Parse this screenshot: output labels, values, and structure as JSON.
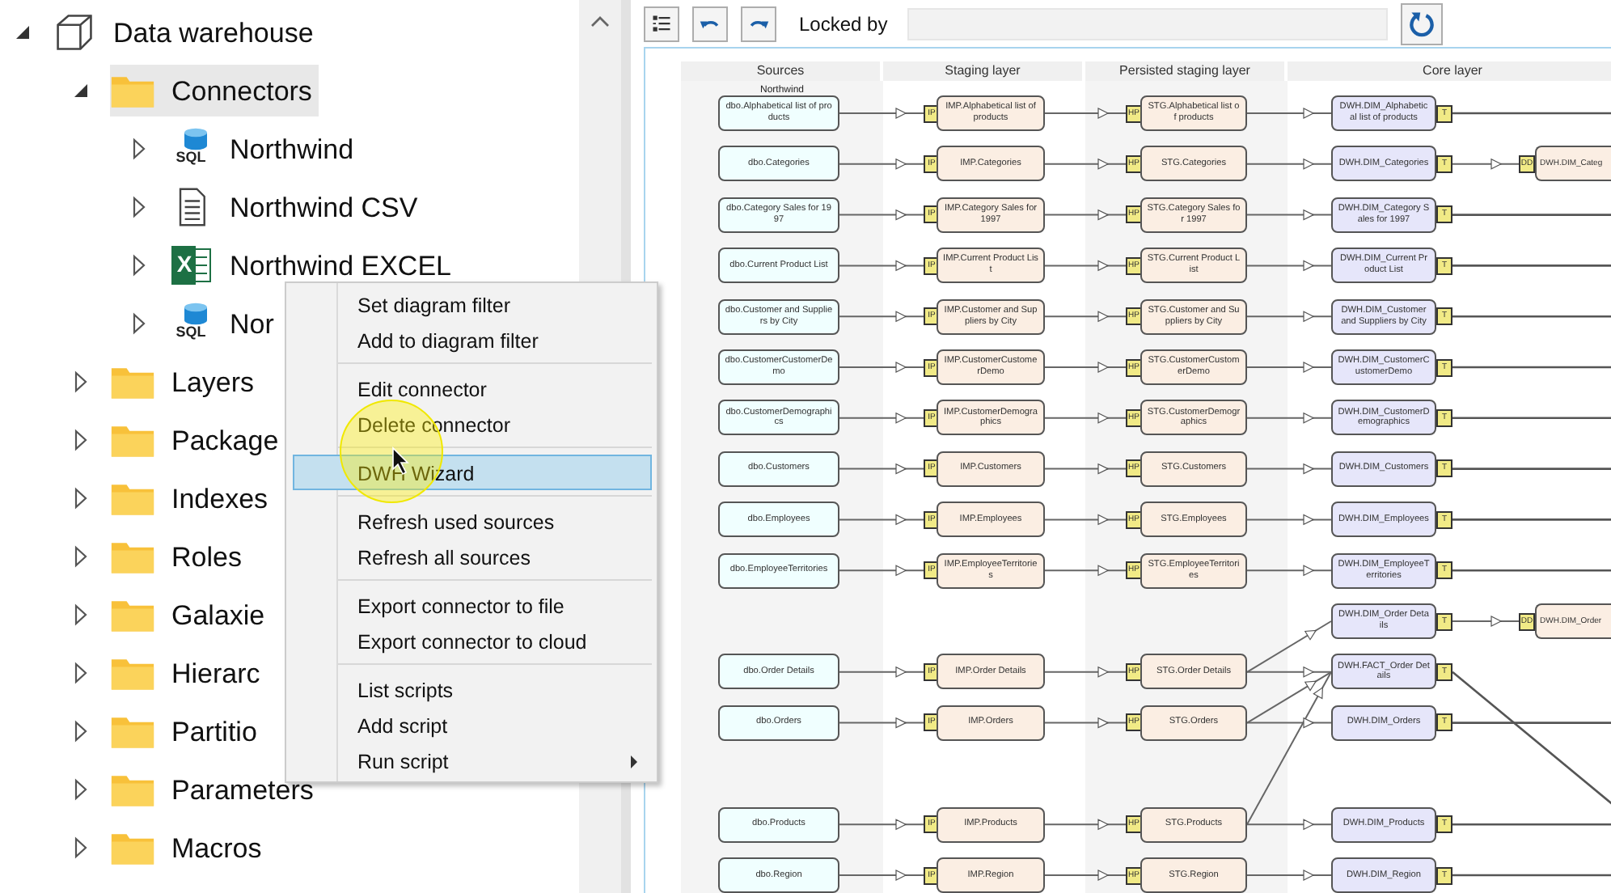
{
  "tree": [
    {
      "label": "Data warehouse",
      "kind": "warehouse",
      "expanded": true,
      "selected": false,
      "children": [
        {
          "label": "Connectors",
          "kind": "folder",
          "expanded": true,
          "selected": true,
          "children": [
            {
              "label": "Northwind",
              "kind": "sql",
              "icon_label": "SQL",
              "expanded": false,
              "selected": false
            },
            {
              "label": "Northwind CSV",
              "kind": "csv",
              "expanded": false,
              "selected": false
            },
            {
              "label": "Northwind EXCEL",
              "kind": "excel",
              "icon_label": "X",
              "expanded": false,
              "selected": false
            },
            {
              "label": "Nor",
              "kind": "sql",
              "icon_label": "SQL",
              "expanded": false,
              "selected": false
            }
          ]
        },
        {
          "label": "Layers",
          "kind": "folder",
          "expanded": false,
          "selected": false
        },
        {
          "label": "Package",
          "kind": "folder",
          "expanded": false,
          "selected": false
        },
        {
          "label": "Indexes",
          "kind": "folder",
          "expanded": false,
          "selected": false
        },
        {
          "label": "Roles",
          "kind": "folder",
          "expanded": false,
          "selected": false
        },
        {
          "label": "Galaxie",
          "kind": "folder",
          "expanded": false,
          "selected": false
        },
        {
          "label": "Hierarc",
          "kind": "folder",
          "expanded": false,
          "selected": false
        },
        {
          "label": "Partitio",
          "kind": "folder",
          "expanded": false,
          "selected": false
        },
        {
          "label": "Parameters",
          "kind": "folder",
          "expanded": false,
          "selected": false
        },
        {
          "label": "Macros",
          "kind": "folder",
          "expanded": false,
          "selected": false
        }
      ]
    }
  ],
  "context_menu": {
    "groups": [
      [
        {
          "label": "Set diagram filter",
          "selected": false,
          "submenu": false
        },
        {
          "label": "Add to diagram filter",
          "selected": false,
          "submenu": false
        }
      ],
      [
        {
          "label": "Edit connector",
          "selected": false,
          "submenu": false
        },
        {
          "label": "Delete connector",
          "selected": false,
          "submenu": false
        }
      ],
      [
        {
          "label": "DWH Wizard",
          "selected": true,
          "submenu": false
        }
      ],
      [
        {
          "label": "Refresh used sources",
          "selected": false,
          "submenu": false
        },
        {
          "label": "Refresh all sources",
          "selected": false,
          "submenu": false
        }
      ],
      [
        {
          "label": "Export connector to file",
          "selected": false,
          "submenu": false
        },
        {
          "label": "Export connector to cloud",
          "selected": false,
          "submenu": false
        }
      ],
      [
        {
          "label": "List scripts",
          "selected": false,
          "submenu": false
        },
        {
          "label": "Add script",
          "selected": false,
          "submenu": false
        },
        {
          "label": "Run script",
          "selected": false,
          "submenu": true
        }
      ]
    ]
  },
  "toolbar": {
    "locked_by_label": "Locked by"
  },
  "diagram": {
    "columns": [
      {
        "title": "Sources",
        "subtitle": "Northwind"
      },
      {
        "title": "Staging layer"
      },
      {
        "title": "Persisted staging layer"
      },
      {
        "title": "Core layer"
      }
    ],
    "rows": [
      {
        "source": "dbo.Alphabetical list of products",
        "staging": {
          "badge": "IP",
          "label": "IMP.Alphabetical list of products"
        },
        "persisted": {
          "badge": "HP",
          "label": "STG.Alphabetical list of products"
        },
        "core": {
          "kind": "dimension",
          "label": "DWH.DIM_Alphabetical list of products",
          "badge": "T"
        }
      },
      {
        "source": "dbo.Categories",
        "staging": {
          "badge": "IP",
          "label": "IMP.Categories"
        },
        "persisted": {
          "badge": "HP",
          "label": "STG.Categories"
        },
        "core": {
          "kind": "dimension",
          "label": "DWH.DIM_Categories",
          "badge": "T"
        },
        "mart": {
          "badge": "DD",
          "label": "DWH.DIM_Categ"
        }
      },
      {
        "source": "dbo.Category Sales for 1997",
        "staging": {
          "badge": "IP",
          "label": "IMP.Category Sales for 1997"
        },
        "persisted": {
          "badge": "HP",
          "label": "STG.Category Sales for 1997"
        },
        "core": {
          "kind": "dimension",
          "label": "DWH.DIM_Category Sales for 1997",
          "badge": "T"
        }
      },
      {
        "source": "dbo.Current Product List",
        "staging": {
          "badge": "IP",
          "label": "IMP.Current Product List"
        },
        "persisted": {
          "badge": "HP",
          "label": "STG.Current Product List"
        },
        "core": {
          "kind": "dimension",
          "label": "DWH.DIM_Current Product List",
          "badge": "T"
        }
      },
      {
        "source": "dbo.Customer and Suppliers by City",
        "staging": {
          "badge": "IP",
          "label": "IMP.Customer and Suppliers by City"
        },
        "persisted": {
          "badge": "HP",
          "label": "STG.Customer and Suppliers by City"
        },
        "core": {
          "kind": "dimension",
          "label": "DWH.DIM_Customer and Suppliers by City",
          "badge": "T"
        }
      },
      {
        "source": "dbo.CustomerCustomerDemo",
        "staging": {
          "badge": "IP",
          "label": "IMP.CustomerCustomerDemo"
        },
        "persisted": {
          "badge": "HP",
          "label": "STG.CustomerCustomerDemo"
        },
        "core": {
          "kind": "dimension",
          "label": "DWH.DIM_CustomerCustomerDemo",
          "badge": "T"
        }
      },
      {
        "source": "dbo.CustomerDemographics",
        "staging": {
          "badge": "IP",
          "label": "IMP.CustomerDemographics"
        },
        "persisted": {
          "badge": "HP",
          "label": "STG.CustomerDemographics"
        },
        "core": {
          "kind": "dimension",
          "label": "DWH.DIM_CustomerDemographics",
          "badge": "T"
        }
      },
      {
        "source": "dbo.Customers",
        "staging": {
          "badge": "IP",
          "label": "IMP.Customers"
        },
        "persisted": {
          "badge": "HP",
          "label": "STG.Customers"
        },
        "core": {
          "kind": "dimension",
          "label": "DWH.DIM_Customers",
          "badge": "T"
        }
      },
      {
        "source": "dbo.Employees",
        "staging": {
          "badge": "IP",
          "label": "IMP.Employees"
        },
        "persisted": {
          "badge": "HP",
          "label": "STG.Employees"
        },
        "core": {
          "kind": "dimension",
          "label": "DWH.DIM_Employees",
          "badge": "T"
        }
      },
      {
        "source": "dbo.EmployeeTerritories",
        "staging": {
          "badge": "IP",
          "label": "IMP.EmployeeTerritories"
        },
        "persisted": {
          "badge": "HP",
          "label": "STG.EmployeeTerritories"
        },
        "core": {
          "kind": "dimension",
          "label": "DWH.DIM_EmployeeTerritories",
          "badge": "T"
        }
      },
      {
        "core": {
          "kind": "dimension",
          "label": "DWH.DIM_Order Details",
          "badge": "T"
        },
        "mart": {
          "badge": "DD",
          "label": "DWH.DIM_Order"
        }
      },
      {
        "source": "dbo.Order Details",
        "staging": {
          "badge": "IP",
          "label": "IMP.Order Details"
        },
        "persisted": {
          "badge": "HP",
          "label": "STG.Order Details"
        },
        "core": {
          "kind": "fact",
          "label": "DWH.FACT_Order Details",
          "badge": "T"
        }
      },
      {
        "source": "dbo.Orders",
        "staging": {
          "badge": "IP",
          "label": "IMP.Orders"
        },
        "persisted": {
          "badge": "HP",
          "label": "STG.Orders"
        },
        "core": {
          "kind": "dimension",
          "label": "DWH.DIM_Orders",
          "badge": "T"
        }
      },
      {
        "source": "dbo.Products",
        "staging": {
          "badge": "IP",
          "label": "IMP.Products"
        },
        "persisted": {
          "badge": "HP",
          "label": "STG.Products"
        },
        "core": {
          "kind": "dimension",
          "label": "DWH.DIM_Products",
          "badge": "T"
        }
      },
      {
        "source": "dbo.Region",
        "staging": {
          "badge": "IP",
          "label": "IMP.Region"
        },
        "persisted": {
          "badge": "HP",
          "label": "STG.Region"
        },
        "core": {
          "kind": "dimension",
          "label": "DWH.DIM_Region",
          "badge": "T"
        }
      }
    ]
  }
}
